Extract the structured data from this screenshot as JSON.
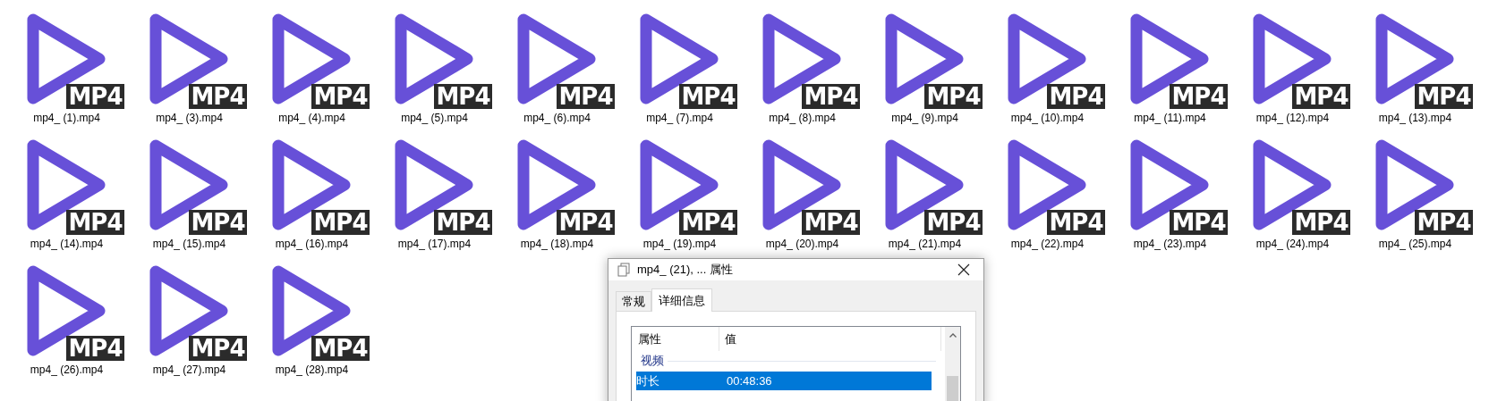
{
  "files": [
    {
      "name": "mp4_ (1).mp4",
      "badge": "MP4"
    },
    {
      "name": "mp4_ (3).mp4",
      "badge": "MP4"
    },
    {
      "name": "mp4_ (4).mp4",
      "badge": "MP4"
    },
    {
      "name": "mp4_ (5).mp4",
      "badge": "MP4"
    },
    {
      "name": "mp4_ (6).mp4",
      "badge": "MP4"
    },
    {
      "name": "mp4_ (7).mp4",
      "badge": "MP4"
    },
    {
      "name": "mp4_ (8).mp4",
      "badge": "MP4"
    },
    {
      "name": "mp4_ (9).mp4",
      "badge": "MP4"
    },
    {
      "name": "mp4_ (10).mp4",
      "badge": "MP4"
    },
    {
      "name": "mp4_ (11).mp4",
      "badge": "MP4"
    },
    {
      "name": "mp4_ (12).mp4",
      "badge": "MP4"
    },
    {
      "name": "mp4_ (13).mp4",
      "badge": "MP4"
    },
    {
      "name": "mp4_ (14).mp4",
      "badge": "MP4"
    },
    {
      "name": "mp4_ (15).mp4",
      "badge": "MP4"
    },
    {
      "name": "mp4_ (16).mp4",
      "badge": "MP4"
    },
    {
      "name": "mp4_ (17).mp4",
      "badge": "MP4"
    },
    {
      "name": "mp4_ (18).mp4",
      "badge": "MP4"
    },
    {
      "name": "mp4_ (19).mp4",
      "badge": "MP4"
    },
    {
      "name": "mp4_ (20).mp4",
      "badge": "MP4"
    },
    {
      "name": "mp4_ (21).mp4",
      "badge": "MP4"
    },
    {
      "name": "mp4_ (22).mp4",
      "badge": "MP4"
    },
    {
      "name": "mp4_ (23).mp4",
      "badge": "MP4"
    },
    {
      "name": "mp4_ (24).mp4",
      "badge": "MP4"
    },
    {
      "name": "mp4_ (25).mp4",
      "badge": "MP4"
    },
    {
      "name": "mp4_ (26).mp4",
      "badge": "MP4"
    },
    {
      "name": "mp4_ (27).mp4",
      "badge": "MP4"
    },
    {
      "name": "mp4_ (28).mp4",
      "badge": "MP4"
    }
  ],
  "dialog": {
    "title": "mp4_ (21), ... 属性",
    "tabs": [
      {
        "label": "常规",
        "selected": false
      },
      {
        "label": "详细信息",
        "selected": true
      }
    ],
    "columns": [
      "属性",
      "值"
    ],
    "group": "视频",
    "rows": [
      {
        "property": "时长",
        "value": "00:48:36",
        "selected": true
      }
    ]
  }
}
